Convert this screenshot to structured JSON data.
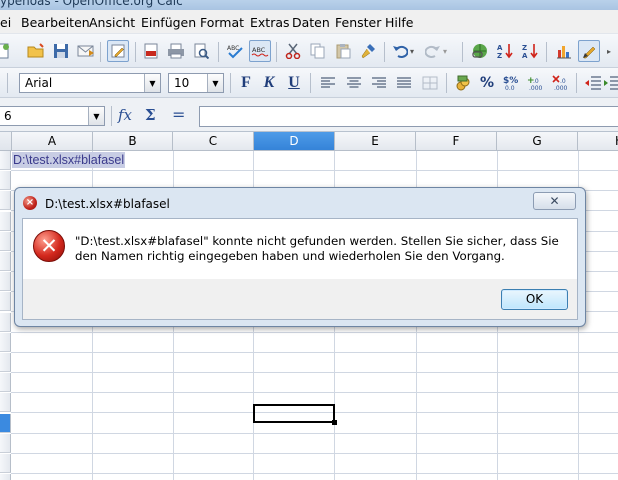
{
  "window": {
    "title": "ypenoas - OpenOffice.org Calc"
  },
  "menubar": {
    "items": [
      {
        "label": "ei"
      },
      {
        "label": "Bearbeiten"
      },
      {
        "label": "Ansicht"
      },
      {
        "label": "Einfügen"
      },
      {
        "label": "Format"
      },
      {
        "label": "Extras"
      },
      {
        "label": "Daten"
      },
      {
        "label": "Fenster"
      },
      {
        "label": "Hilfe"
      }
    ]
  },
  "format_toolbar": {
    "font_name": "Arial",
    "font_size": "10",
    "bold_label": "F",
    "italic_label": "K",
    "underline_label": "U"
  },
  "formula_bar": {
    "name_box": "6",
    "formula_value": ""
  },
  "sheet": {
    "columns": [
      "A",
      "B",
      "C",
      "D",
      "E",
      "F",
      "G",
      "H"
    ],
    "selected_column": "D",
    "cell_a1": "D:\\test.xlsx#blafasel"
  },
  "dialog": {
    "title": "D:\\test.xlsx#blafasel",
    "message": "\"D:\\test.xlsx#blafasel\" konnte nicht gefunden werden. Stellen Sie sicher, dass Sie den Namen richtig eingegeben haben und wiederholen Sie den Vorgang.",
    "ok_label": "OK",
    "close_symbol": "✕"
  },
  "colors": {
    "selection_header": "#3583d8",
    "error_red": "#d3281d",
    "dialog_frame": "#dbe6f2"
  }
}
